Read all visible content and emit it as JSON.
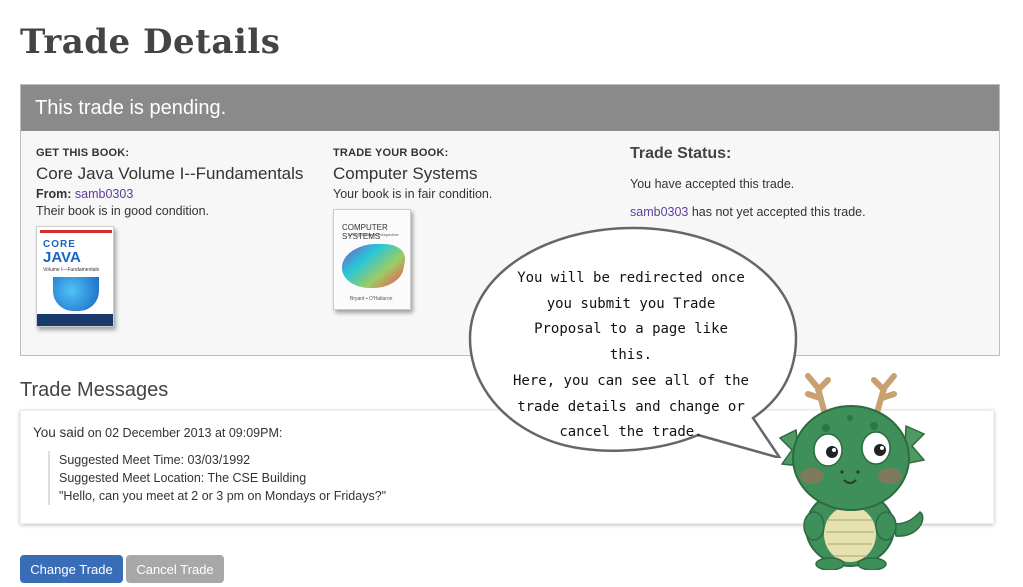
{
  "page": {
    "title": "Trade Details"
  },
  "panel": {
    "header": "This trade is pending.",
    "get": {
      "label": "GET THIS BOOK:",
      "book_title": "Core Java Volume I--Fundamentals",
      "from_label": "From:",
      "from_user": "samb0303",
      "condition": "Their book is in good condition.",
      "cover": {
        "line1": "CORE",
        "line2": "JAVA",
        "line3": "Volume I—Fundamentals"
      }
    },
    "trade": {
      "label": "TRADE YOUR BOOK:",
      "book_title": "Computer Systems",
      "condition": "Your book is in fair condition.",
      "cover": {
        "line1": "COMPUTER SYSTEMS",
        "line2": "A Programmer's Perspective",
        "line3": "Bryant • O'Hallaron"
      }
    },
    "status": {
      "title": "Trade Status:",
      "line1": "You have accepted this trade.",
      "user": "samb0303",
      "line2_rest": " has not yet accepted this trade."
    }
  },
  "messages": {
    "title": "Trade Messages",
    "you_said": "You said",
    "date": " on 02 December 2013 at 09:09PM:",
    "meet_time_label": "Suggested Meet Time:",
    "meet_time": " 03/03/1992",
    "meet_location_label": "Suggested Meet Location:",
    "meet_location": " The CSE Building",
    "quote": "\"Hello, can you meet at 2 or 3 pm on Mondays or Fridays?\""
  },
  "buttons": {
    "change": "Change Trade",
    "cancel": "Cancel Trade"
  },
  "callout": {
    "lines": [
      "You will be redirected once",
      "you submit you Trade",
      "Proposal to a page like this.",
      "Here, you can see all of the",
      "trade details and change or",
      "cancel the trade."
    ]
  },
  "colors": {
    "header": "#8a8a8a",
    "link": "#5b3e9c",
    "primary_button": "#3a6db8",
    "secondary_button": "#a8a8a8",
    "mascot": "#3f8f5a"
  }
}
